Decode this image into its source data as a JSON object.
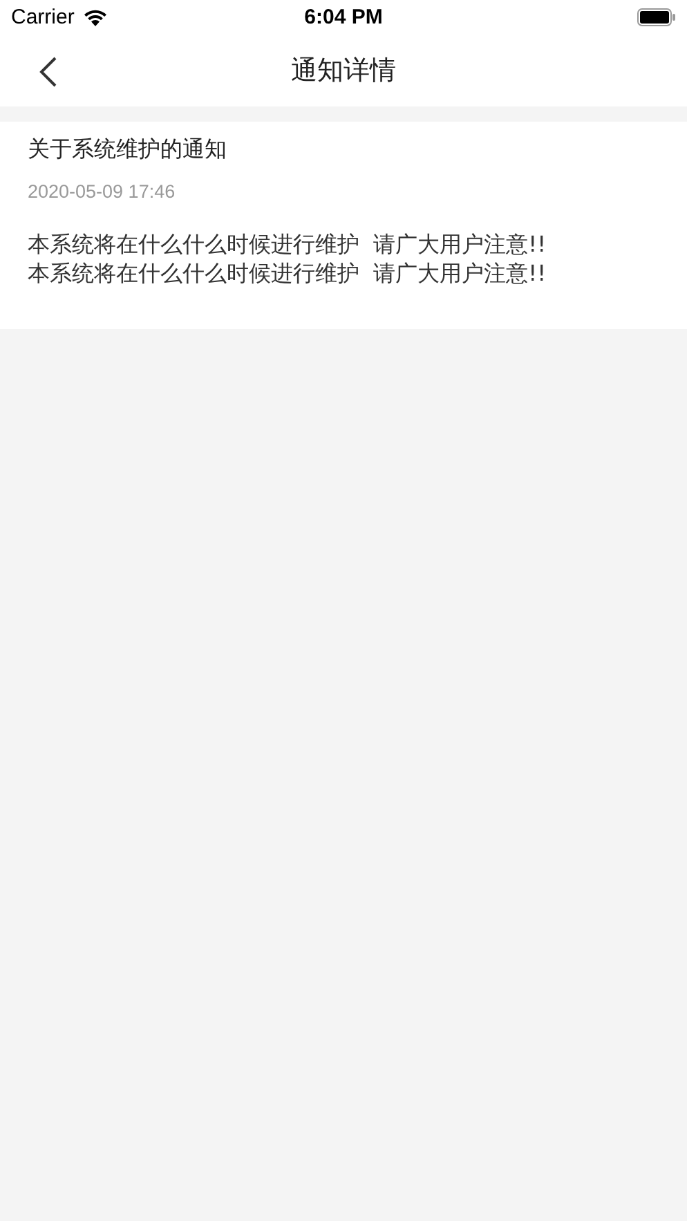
{
  "status_bar": {
    "carrier": "Carrier",
    "time": "6:04 PM"
  },
  "nav_bar": {
    "title": "通知详情"
  },
  "notice": {
    "title": "关于系统维护的通知",
    "date": "2020-05-09 17:46",
    "body_lines": [
      "本系统将在什么什么时候进行维护  请广大用户注意!!",
      "本系统将在什么什么时候进行维护  请广大用户注意!!"
    ]
  }
}
